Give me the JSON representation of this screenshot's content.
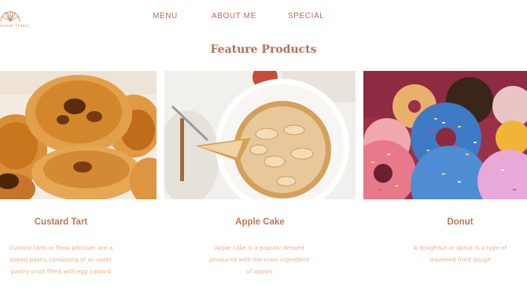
{
  "brand": {
    "text": "Sweet Treats"
  },
  "nav": {
    "menu": "MENU",
    "about": "ABOUT ME",
    "special": "SPECIAL"
  },
  "section": {
    "title": "Feature Products"
  },
  "products": [
    {
      "name": "Custard Tart",
      "desc": [
        "Custard tarts or flans pâtissier are a",
        "baked pastry consisting of an outer",
        "pastry crust filled with egg custard"
      ]
    },
    {
      "name": "Apple Cake",
      "desc": [
        "Apple cake is a popular dessert",
        "produced with the main ingredient",
        "of apples"
      ]
    },
    {
      "name": "Donut",
      "desc": [
        "A doughnut or donut is a type of",
        "leavened fried dough"
      ]
    }
  ],
  "colors": {
    "accent": "#b76e55",
    "title": "#c0775a",
    "desc": "#e9b08a"
  }
}
